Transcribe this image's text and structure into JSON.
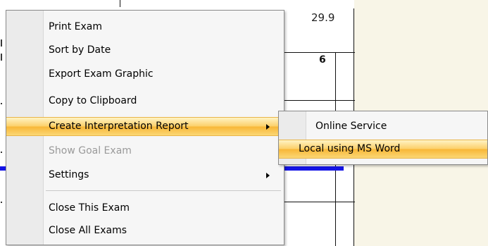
{
  "background": {
    "value_text": "29.9",
    "column_header": "6"
  },
  "context_menu": {
    "items": [
      {
        "label": "Print Exam",
        "mnemonic": "E"
      },
      {
        "label": "Sort by Date",
        "mnemonic": "D"
      },
      {
        "label": "Export Exam Graphic"
      },
      {
        "label": "Copy to Clipboard"
      },
      {
        "label": "Create Interpretation Report",
        "mnemonic": "I",
        "highlighted": true,
        "has_submenu": true
      },
      {
        "label": "Show Goal Exam",
        "disabled": true
      },
      {
        "label": "Settings",
        "has_submenu": true
      },
      {
        "label": "Close This Exam"
      },
      {
        "label": "Close All Exams",
        "mnemonic": "C"
      }
    ]
  },
  "submenu": {
    "items": [
      {
        "label": "Online Service",
        "mnemonic": "O"
      },
      {
        "label": "Local using MS Word",
        "highlighted": true
      }
    ]
  },
  "colors": {
    "highlight": "#f8b737",
    "series_line": "#1414e6",
    "right_panel": "#f8f5e7"
  }
}
